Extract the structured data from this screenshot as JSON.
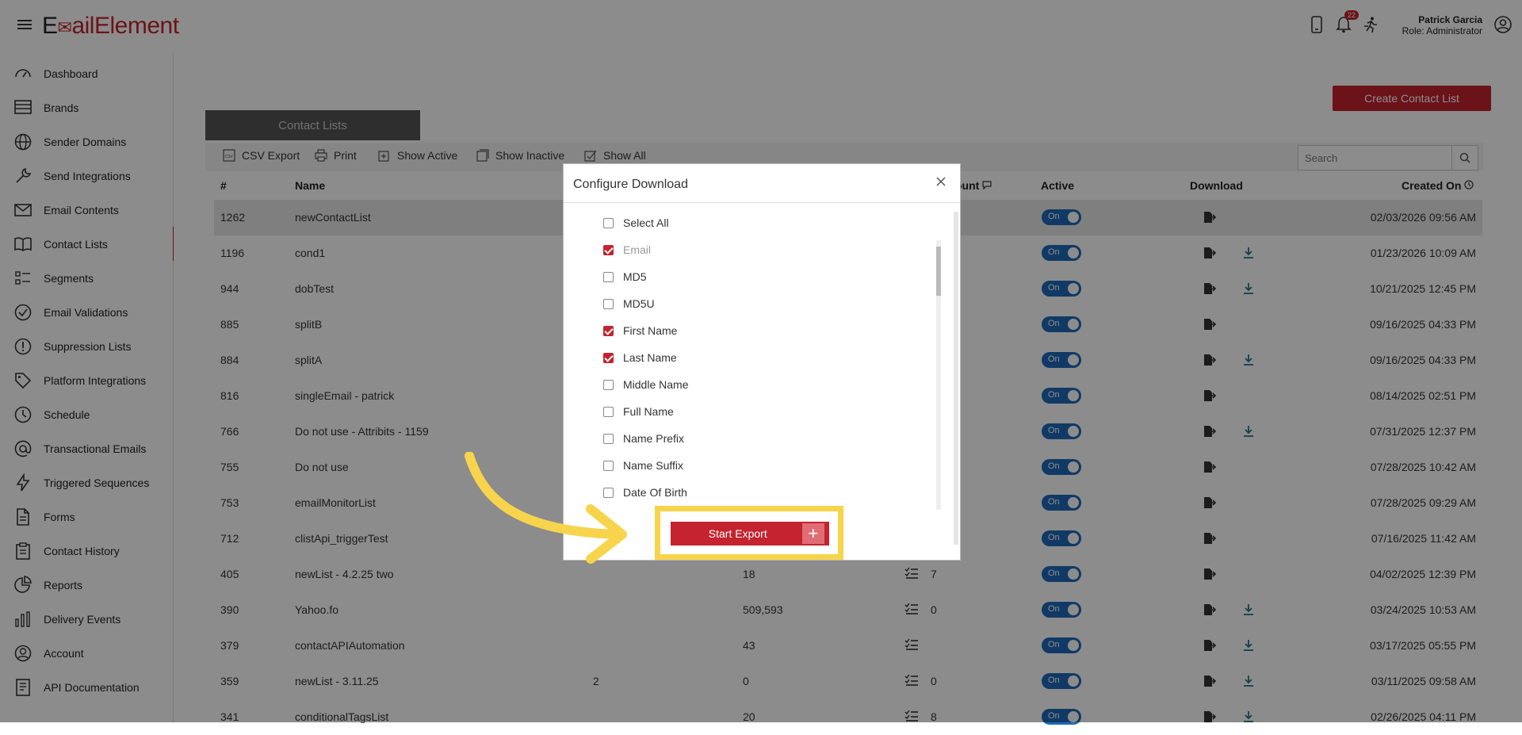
{
  "app": {
    "logo_prefix": "E",
    "logo_mid": "ail",
    "logo_suffix": "Element"
  },
  "topbar": {
    "notification_count": "22",
    "user_name": "Patrick Garcia",
    "user_role": "Role: Administrator"
  },
  "sidebar": {
    "items": [
      {
        "label": "Dashboard",
        "icon": "gauge-icon"
      },
      {
        "label": "Brands",
        "icon": "list-icon"
      },
      {
        "label": "Sender Domains",
        "icon": "globe-icon"
      },
      {
        "label": "Send Integrations",
        "icon": "wrench-icon"
      },
      {
        "label": "Email Contents",
        "icon": "mail-icon"
      },
      {
        "label": "Contact Lists",
        "icon": "book-icon"
      },
      {
        "label": "Segments",
        "icon": "segments-icon"
      },
      {
        "label": "Email Validations",
        "icon": "check-circle-icon"
      },
      {
        "label": "Suppression Lists",
        "icon": "alert-circle-icon"
      },
      {
        "label": "Platform Integrations",
        "icon": "tag-icon"
      },
      {
        "label": "Schedule",
        "icon": "clock-icon"
      },
      {
        "label": "Transactional Emails",
        "icon": "at-icon"
      },
      {
        "label": "Triggered Sequences",
        "icon": "bolt-icon"
      },
      {
        "label": "Forms",
        "icon": "doc-icon"
      },
      {
        "label": "Contact History",
        "icon": "clipboard-icon"
      },
      {
        "label": "Reports",
        "icon": "pie-icon"
      },
      {
        "label": "Delivery Events",
        "icon": "bars-icon"
      },
      {
        "label": "Account",
        "icon": "user-icon"
      },
      {
        "label": "API Documentation",
        "icon": "api-doc-icon"
      }
    ]
  },
  "main": {
    "create_button": "Create Contact List",
    "tab_label": "Contact Lists",
    "toolbar": {
      "csv_export": "CSV Export",
      "print": "Print",
      "show_active": "Show Active",
      "show_inactive": "Show Inactive",
      "show_all": "Show All"
    },
    "search_placeholder": "Search",
    "columns": {
      "id": "#",
      "name": "Name",
      "count": "ount",
      "active": "Active",
      "download": "Download",
      "created": "Created On"
    },
    "toggle_label": "On",
    "rows": [
      {
        "id": "1262",
        "name": "newContactList",
        "c3": "",
        "c4": "",
        "c5": "",
        "created": "02/03/2026 09:56 AM",
        "dl2": false
      },
      {
        "id": "1196",
        "name": "cond1",
        "c3": "",
        "c4": "",
        "c5": "",
        "created": "01/23/2026 10:09 AM",
        "dl2": true
      },
      {
        "id": "944",
        "name": "dobTest",
        "c3": "",
        "c4": "",
        "c5": "",
        "created": "10/21/2025 12:45 PM",
        "dl2": true
      },
      {
        "id": "885",
        "name": "splitB",
        "c3": "",
        "c4": "",
        "c5": "",
        "created": "09/16/2025 04:33 PM",
        "dl2": false
      },
      {
        "id": "884",
        "name": "splitA",
        "c3": "",
        "c4": "",
        "c5": "",
        "created": "09/16/2025 04:33 PM",
        "dl2": true
      },
      {
        "id": "816",
        "name": "singleEmail - patrick",
        "c3": "",
        "c4": "",
        "c5": "",
        "created": "08/14/2025 02:51 PM",
        "dl2": false
      },
      {
        "id": "766",
        "name": "Do not use - Attribits - 1159",
        "c3": "",
        "c4": "",
        "c5": "",
        "created": "07/31/2025 12:37 PM",
        "dl2": true
      },
      {
        "id": "755",
        "name": "Do not use",
        "c3": "",
        "c4": "",
        "c5": "",
        "created": "07/28/2025 10:42 AM",
        "dl2": false
      },
      {
        "id": "753",
        "name": "emailMonitorList",
        "c3": "",
        "c4": "",
        "c5": "",
        "created": "07/28/2025 09:29 AM",
        "dl2": false
      },
      {
        "id": "712",
        "name": "clistApi_triggerTest",
        "c3": "",
        "c4": "",
        "c5": "",
        "created": "07/16/2025 11:42 AM",
        "dl2": false
      },
      {
        "id": "405",
        "name": "newList - 4.2.25 two",
        "c3": "",
        "c4": "18",
        "c5": "7",
        "created": "04/02/2025 12:39 PM",
        "dl2": false
      },
      {
        "id": "390",
        "name": "Yahoo.fo",
        "c3": "",
        "c4": "509,593",
        "c5": "0",
        "created": "03/24/2025 10:53 AM",
        "dl2": true
      },
      {
        "id": "379",
        "name": "contactAPIAutomation",
        "c3": "",
        "c4": "43",
        "c5": "",
        "created": "03/17/2025 05:55 PM",
        "dl2": true
      },
      {
        "id": "359",
        "name": "newList - 3.11.25",
        "c3": "2",
        "c4": "0",
        "c5": "0",
        "created": "03/11/2025 09:58 AM",
        "dl2": true
      },
      {
        "id": "341",
        "name": "conditionalTagsList",
        "c3": "",
        "c4": "20",
        "c5": "8",
        "created": "02/26/2025 04:11 PM",
        "dl2": true
      }
    ]
  },
  "modal": {
    "title": "Configure Download",
    "options": [
      {
        "label": "Select All",
        "checked": false,
        "dim": false
      },
      {
        "label": "Email",
        "checked": true,
        "dim": true
      },
      {
        "label": "MD5",
        "checked": false,
        "dim": false
      },
      {
        "label": "MD5U",
        "checked": false,
        "dim": false
      },
      {
        "label": "First Name",
        "checked": true,
        "dim": false
      },
      {
        "label": "Last Name",
        "checked": true,
        "dim": false
      },
      {
        "label": "Middle Name",
        "checked": false,
        "dim": false
      },
      {
        "label": "Full Name",
        "checked": false,
        "dim": false
      },
      {
        "label": "Name Prefix",
        "checked": false,
        "dim": false
      },
      {
        "label": "Name Suffix",
        "checked": false,
        "dim": false
      },
      {
        "label": "Date Of Birth",
        "checked": false,
        "dim": false
      }
    ],
    "start_export": "Start Export",
    "plus": "+"
  },
  "colors": {
    "brand": "#c4232f",
    "toggle": "#1e6bb8",
    "highlight": "#f7d44c"
  }
}
